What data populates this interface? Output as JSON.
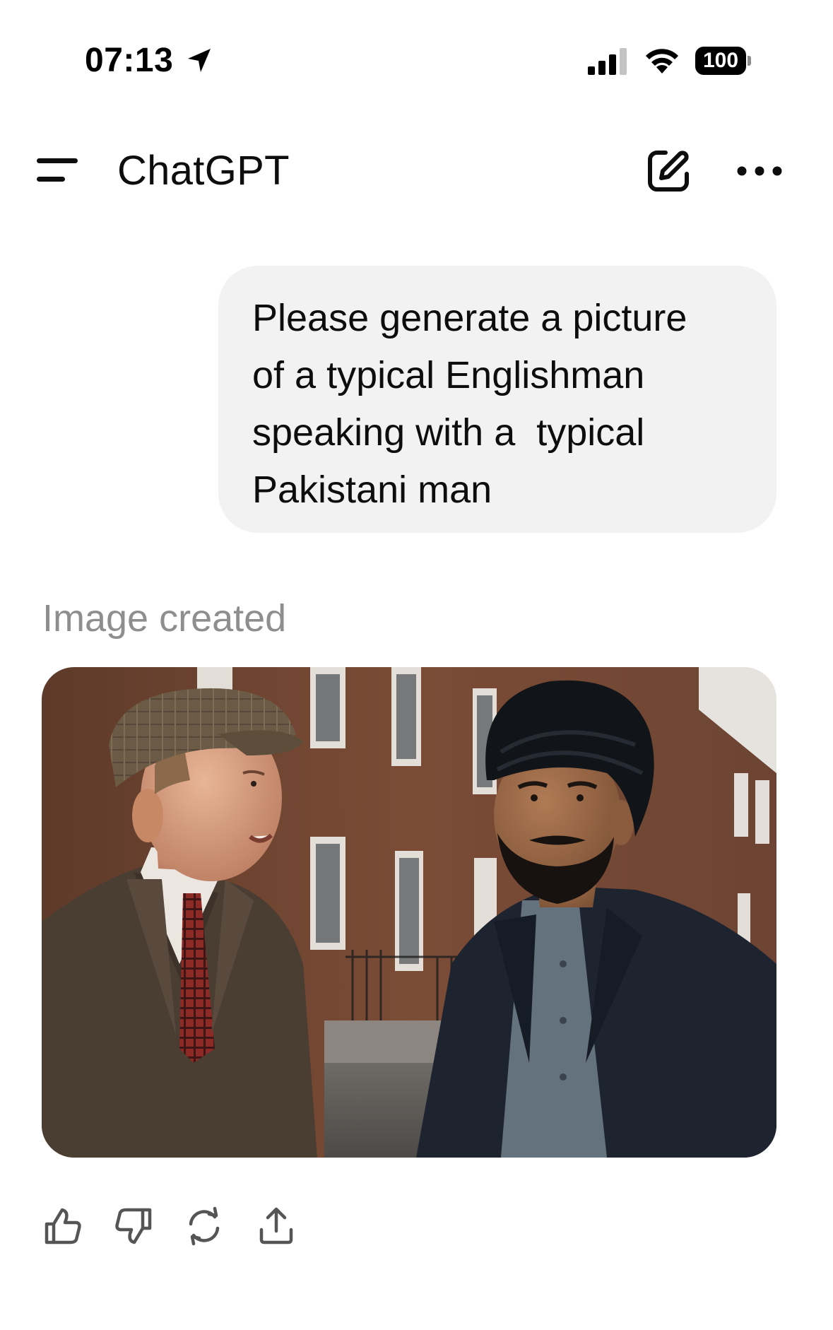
{
  "status_bar": {
    "time": "07:13",
    "battery_level": "100",
    "icons": [
      "location-arrow-icon",
      "cellular-signal-icon",
      "wifi-icon",
      "battery-icon"
    ]
  },
  "header": {
    "title": "ChatGPT",
    "icons": [
      "sidebar-menu-icon",
      "new-chat-icon",
      "more-options-icon"
    ]
  },
  "conversation": {
    "user_message": "Please generate a picture\nof a typical Englishman\nspeaking with a  typical\nPakistani man",
    "assistant": {
      "caption": "Image created",
      "image": {
        "subject": "generated-image",
        "palette": {
          "brick": "#7a4a35",
          "sky": "#e8e6e1",
          "tweed_jacket": "#4a3d32",
          "navy_jacket": "#1d2430",
          "shirt_grey": "#64727d",
          "turban": "#111418",
          "flat_cap": "#6b5a45",
          "tie_red": "#8e2a25"
        }
      }
    },
    "actions": [
      {
        "name": "thumbs-up-icon"
      },
      {
        "name": "thumbs-down-icon"
      },
      {
        "name": "regenerate-icon"
      },
      {
        "name": "share-icon"
      }
    ]
  },
  "colors": {
    "bubble_bg": "#f2f2f2",
    "caption_text": "#8e8e8e",
    "primary_text": "#0d0d0d"
  }
}
